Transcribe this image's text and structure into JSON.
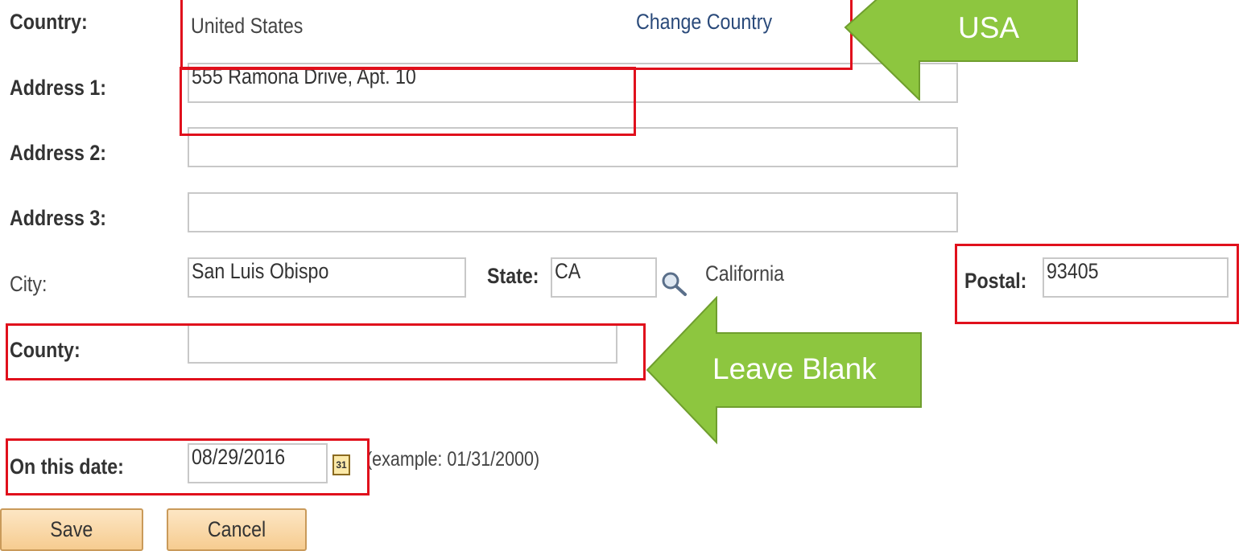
{
  "form": {
    "country": {
      "label": "Country:",
      "value": "United States",
      "change_link": "Change Country"
    },
    "address1": {
      "label": "Address 1:",
      "value": "555 Ramona Drive, Apt. 10"
    },
    "address2": {
      "label": "Address 2:",
      "value": ""
    },
    "address3": {
      "label": "Address 3:",
      "value": ""
    },
    "city": {
      "label": "City:",
      "value": "San Luis Obispo"
    },
    "state": {
      "label": "State:",
      "value": "CA",
      "name": "California",
      "lookup_icon": "magnifier-icon"
    },
    "postal": {
      "label": "Postal:",
      "value": "93405"
    },
    "county": {
      "label": "County:",
      "value": ""
    },
    "date": {
      "label": "On this date:",
      "value": "08/29/2016",
      "calendar_icon": "calendar-icon",
      "calendar_icon_text": "31",
      "example": "(example: 01/31/2000)"
    },
    "buttons": {
      "save": "Save",
      "cancel": "Cancel"
    }
  },
  "annotations": {
    "usa_callout": "USA",
    "county_callout": "Leave Blank",
    "callout_color": "#8dc63f",
    "highlight_color": "#e0101c"
  }
}
